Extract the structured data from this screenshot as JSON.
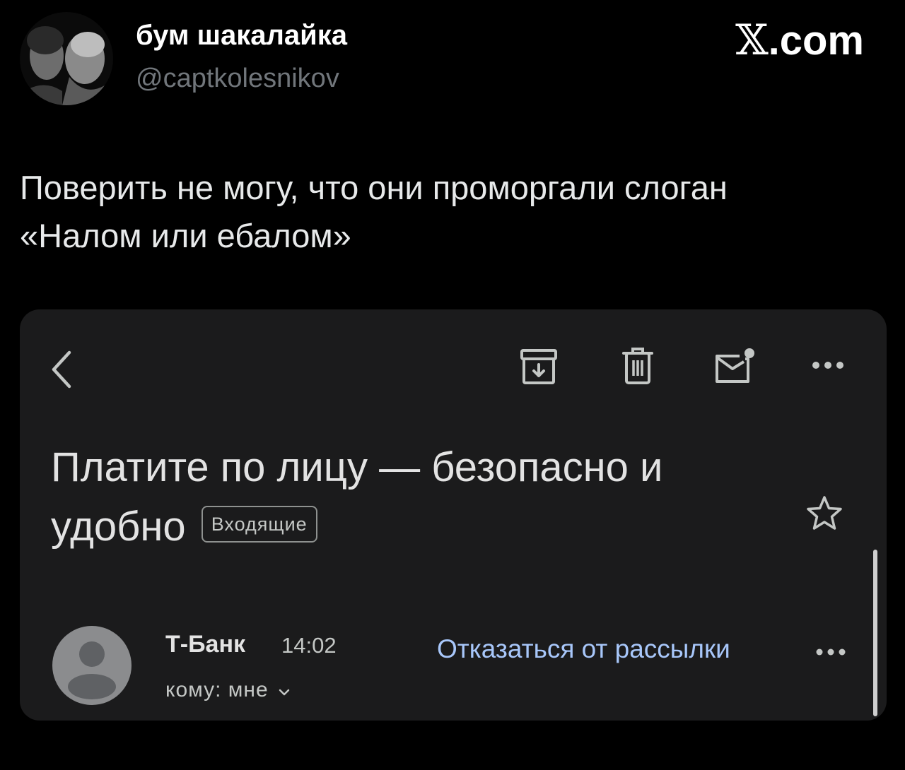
{
  "tweet": {
    "display_name": "бум шакалайка",
    "handle": "@captkolesnikov",
    "brand_x": "𝕏",
    "brand_domain": ".com",
    "text_line1": "Поверить не могу, что они проморгали слоган",
    "text_line2": "«Налом или ебалом»"
  },
  "mail": {
    "toolbar_icons": [
      "back-icon",
      "archive-icon",
      "delete-icon",
      "mark-unread-icon",
      "more-icon"
    ],
    "subject_line1": "Платите по лицу — безопасно и",
    "subject_line2": "удобно",
    "label": "Входящие",
    "sender_name": "Т-Банк",
    "time": "14:02",
    "recipient": "кому: мне",
    "unsubscribe": "Отказаться от рассылки"
  },
  "colors": {
    "background": "#000000",
    "card": "#1b1b1c",
    "link": "#a8c7fa",
    "handle": "#71767b"
  }
}
